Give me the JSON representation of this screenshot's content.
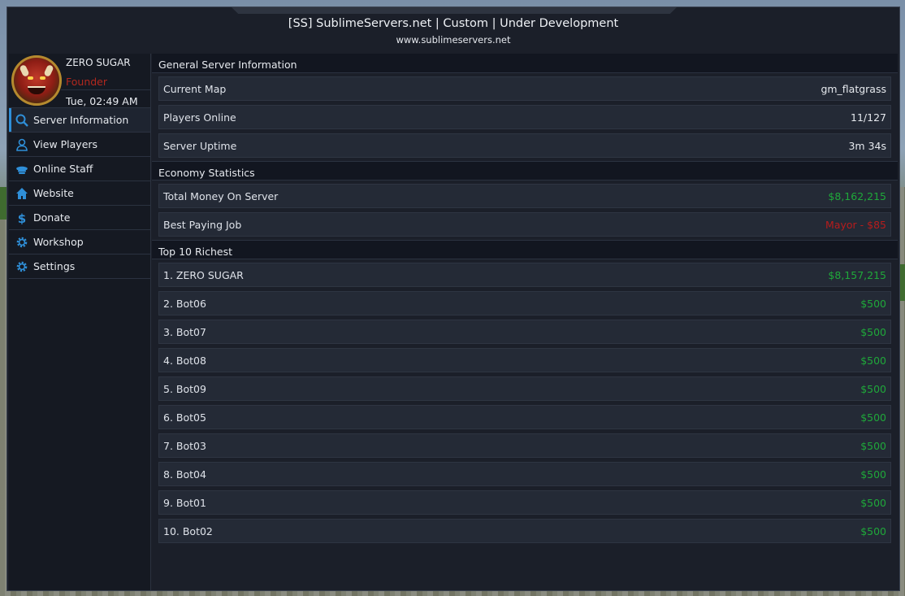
{
  "window": {
    "title": "[SS] SublimeServers.net | Custom | Under Development",
    "subtitle": "www.sublimeservers.net"
  },
  "profile": {
    "name": "ZERO SUGAR",
    "rank": "Founder",
    "time": "Tue, 02:49 AM",
    "rank_color": "#b3281e"
  },
  "nav": {
    "items": [
      {
        "label": "Server Information",
        "icon": "search-icon"
      },
      {
        "label": "View Players",
        "icon": "user-icon"
      },
      {
        "label": "Online Staff",
        "icon": "police-cap-icon"
      },
      {
        "label": "Website",
        "icon": "home-icon"
      },
      {
        "label": "Donate",
        "icon": "dollar-icon"
      },
      {
        "label": "Workshop",
        "icon": "gear-icon"
      },
      {
        "label": "Settings",
        "icon": "gear-icon"
      }
    ],
    "active_color": "#2f8fd8",
    "icon_color": "#2f8fd8"
  },
  "general": {
    "heading": "General Server Information",
    "rows": [
      {
        "label": "Current Map",
        "value": "gm_flatgrass"
      },
      {
        "label": "Players Online",
        "value": "11/127"
      },
      {
        "label": "Server Uptime",
        "value": "3m 34s"
      }
    ]
  },
  "economy": {
    "heading": "Economy Statistics",
    "rows": [
      {
        "label": "Total Money On Server",
        "value": "$8,162,215"
      },
      {
        "label": "Best Paying Job",
        "value": "Mayor - $85"
      }
    ]
  },
  "richest": {
    "heading": "Top 10 Richest",
    "rows": [
      {
        "label": "1. ZERO SUGAR",
        "value": "$8,157,215"
      },
      {
        "label": "2. Bot06",
        "value": "$500"
      },
      {
        "label": "3. Bot07",
        "value": "$500"
      },
      {
        "label": "4. Bot08",
        "value": "$500"
      },
      {
        "label": "5. Bot09",
        "value": "$500"
      },
      {
        "label": "6. Bot05",
        "value": "$500"
      },
      {
        "label": "7. Bot03",
        "value": "$500"
      },
      {
        "label": "8. Bot04",
        "value": "$500"
      },
      {
        "label": "9. Bot01",
        "value": "$500"
      },
      {
        "label": "10. Bot02",
        "value": "$500"
      }
    ]
  },
  "colors": {
    "money": "#1fa83a",
    "job": "#b71c1c"
  }
}
